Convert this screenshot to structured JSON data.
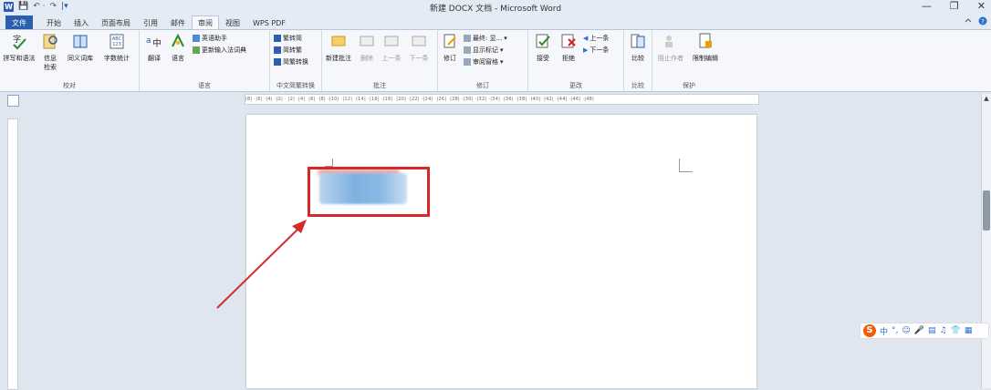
{
  "window": {
    "title": "新建 DOCX 文档 - Microsoft Word",
    "controls": [
      "—",
      "❐",
      "✕"
    ]
  },
  "quick_access": {
    "app_logo": "W",
    "save": "💾",
    "undo": "↶ ·",
    "redo": "↷",
    "customize": "|▾"
  },
  "tabs": [
    "文件",
    "开始",
    "插入",
    "页面布局",
    "引用",
    "邮件",
    "审阅",
    "视图",
    "WPS PDF"
  ],
  "active_tab": "审阅",
  "ribbon": {
    "proofing": {
      "label": "校对",
      "buttons": [
        "拼写和语法",
        "信息检索",
        "同义词库",
        "字数统计"
      ]
    },
    "language": {
      "label": "语言",
      "buttons": [
        "翻译",
        "语言"
      ],
      "small": [
        "英语助手",
        "更新输入法词典"
      ]
    },
    "chinese_conv": {
      "label": "中文简繁转换",
      "small": [
        "繁转简",
        "简转繁",
        "简繁转换"
      ]
    },
    "comments": {
      "label": "批注",
      "buttons": [
        "新建批注",
        "删除",
        "上一条",
        "下一条"
      ]
    },
    "tracking": {
      "label": "修订",
      "buttons": [
        "修订"
      ],
      "small": [
        "最终: 显...",
        "显示标记",
        "审阅窗格"
      ]
    },
    "changes": {
      "label": "更改",
      "buttons": [
        "接受",
        "拒绝"
      ],
      "small": [
        "上一条",
        "下一条"
      ]
    },
    "compare": {
      "label": "比较",
      "buttons": [
        "比较"
      ]
    },
    "protect": {
      "label": "保护",
      "buttons": [
        "阻止作者",
        "限制编辑"
      ]
    }
  },
  "ruler_text": "|8| ·|6| ·|4| ·|2| · |2| ·|4| ·|6| ·|8| ·|10| ·|12| ·|14| ·|16| ·|18| ·|20| ·|22| ·|24| ·|26| ·|28| ·|30| ·|32| ·|34| ·|36| ·|38| ·|40| ·|42| ·|44| ·|46| ·|48|",
  "ime": {
    "logo": "S",
    "items": [
      "中",
      "°,",
      "☺",
      "🎤",
      "▤",
      "♫",
      "👕",
      "▦"
    ]
  },
  "colors": {
    "accent": "#2b5fae",
    "highlight": "#d62a2a"
  }
}
